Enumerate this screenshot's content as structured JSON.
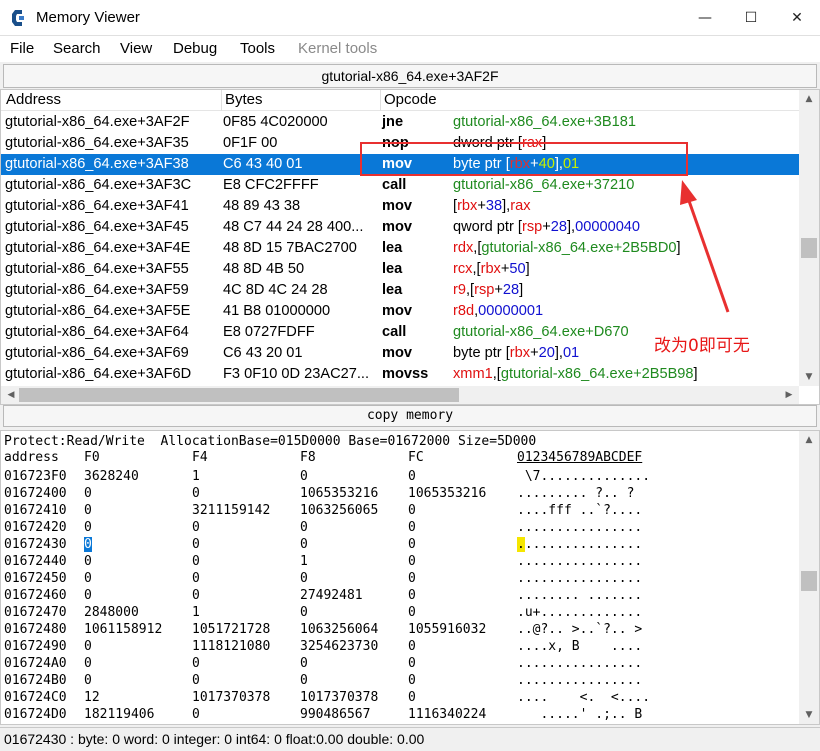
{
  "window": {
    "title": "Memory Viewer",
    "controls": {
      "minimize": "—",
      "maximize": "☐",
      "close": "✕"
    }
  },
  "menu": [
    "File",
    "Search",
    "View",
    "Debug",
    "Tools",
    "Kernel tools"
  ],
  "address_bar": "gtutorial-x86_64.exe+3AF2F",
  "disassembly": {
    "headers": {
      "address": "Address",
      "bytes": "Bytes",
      "opcode": "Opcode"
    },
    "rows": [
      {
        "address": "gtutorial-x86_64.exe+3AF2F",
        "bytes": "0F85 4C020000",
        "opcode": "jne",
        "args": [
          {
            "t": "gtutorial-x86_64.exe+3B181",
            "c": "green"
          }
        ]
      },
      {
        "address": "gtutorial-x86_64.exe+3AF35",
        "bytes": "0F1F 00",
        "opcode": "nop",
        "args": [
          {
            "t": "dword ptr [",
            "c": ""
          },
          {
            "t": "rax",
            "c": "red"
          },
          {
            "t": "]",
            "c": ""
          }
        ]
      },
      {
        "address": "gtutorial-x86_64.exe+3AF38",
        "bytes": "C6 43 40 01",
        "opcode": "mov",
        "selected": true,
        "args": [
          {
            "t": "byte ptr [",
            "c": ""
          },
          {
            "t": "rbx",
            "c": "reg"
          },
          {
            "t": "+",
            "c": ""
          },
          {
            "t": "40",
            "c": "num"
          },
          {
            "t": "],",
            "c": ""
          },
          {
            "t": "01",
            "c": "num"
          }
        ]
      },
      {
        "address": "gtutorial-x86_64.exe+3AF3C",
        "bytes": "E8 CFC2FFFF",
        "opcode": "call",
        "args": [
          {
            "t": "gtutorial-x86_64.exe+37210",
            "c": "green"
          }
        ]
      },
      {
        "address": "gtutorial-x86_64.exe+3AF41",
        "bytes": "48 89 43 38",
        "opcode": "mov",
        "args": [
          {
            "t": "[",
            "c": ""
          },
          {
            "t": "rbx",
            "c": "red"
          },
          {
            "t": "+",
            "c": ""
          },
          {
            "t": "38",
            "c": "blue"
          },
          {
            "t": "],",
            "c": ""
          },
          {
            "t": "rax",
            "c": "red"
          }
        ]
      },
      {
        "address": "gtutorial-x86_64.exe+3AF45",
        "bytes": "48 C7 44 24 28 400...",
        "opcode": "mov",
        "args": [
          {
            "t": "qword ptr [",
            "c": ""
          },
          {
            "t": "rsp",
            "c": "red"
          },
          {
            "t": "+",
            "c": ""
          },
          {
            "t": "28",
            "c": "blue"
          },
          {
            "t": "],",
            "c": ""
          },
          {
            "t": "00000040",
            "c": "blue"
          }
        ]
      },
      {
        "address": "gtutorial-x86_64.exe+3AF4E",
        "bytes": "48 8D 15 7BAC2700",
        "opcode": "lea",
        "args": [
          {
            "t": "rdx",
            "c": "red"
          },
          {
            "t": ",[",
            "c": ""
          },
          {
            "t": "gtutorial-x86_64.exe+2B5BD0",
            "c": "green"
          },
          {
            "t": "]",
            "c": ""
          }
        ]
      },
      {
        "address": "gtutorial-x86_64.exe+3AF55",
        "bytes": "48 8D 4B 50",
        "opcode": "lea",
        "args": [
          {
            "t": "rcx",
            "c": "red"
          },
          {
            "t": ",[",
            "c": ""
          },
          {
            "t": "rbx",
            "c": "red"
          },
          {
            "t": "+",
            "c": ""
          },
          {
            "t": "50",
            "c": "blue"
          },
          {
            "t": "]",
            "c": ""
          }
        ]
      },
      {
        "address": "gtutorial-x86_64.exe+3AF59",
        "bytes": "4C 8D 4C 24 28",
        "opcode": "lea",
        "args": [
          {
            "t": "r9",
            "c": "red"
          },
          {
            "t": ",[",
            "c": ""
          },
          {
            "t": "rsp",
            "c": "red"
          },
          {
            "t": "+",
            "c": ""
          },
          {
            "t": "28",
            "c": "blue"
          },
          {
            "t": "]",
            "c": ""
          }
        ]
      },
      {
        "address": "gtutorial-x86_64.exe+3AF5E",
        "bytes": "41 B8 01000000",
        "opcode": "mov",
        "args": [
          {
            "t": "r8d",
            "c": "red"
          },
          {
            "t": ",",
            "c": ""
          },
          {
            "t": "00000001",
            "c": "blue"
          }
        ]
      },
      {
        "address": "gtutorial-x86_64.exe+3AF64",
        "bytes": "E8 0727FDFF",
        "opcode": "call",
        "args": [
          {
            "t": "gtutorial-x86_64.exe+D670",
            "c": "green"
          }
        ]
      },
      {
        "address": "gtutorial-x86_64.exe+3AF69",
        "bytes": "C6 43 20 01",
        "opcode": "mov",
        "args": [
          {
            "t": "byte ptr [",
            "c": ""
          },
          {
            "t": "rbx",
            "c": "red"
          },
          {
            "t": "+",
            "c": ""
          },
          {
            "t": "20",
            "c": "blue"
          },
          {
            "t": "],",
            "c": ""
          },
          {
            "t": "01",
            "c": "blue"
          }
        ]
      },
      {
        "address": "gtutorial-x86_64.exe+3AF6D",
        "bytes": "F3 0F10 0D 23AC27...",
        "opcode": "movss",
        "args": [
          {
            "t": "xmm1",
            "c": "red"
          },
          {
            "t": ",[",
            "c": ""
          },
          {
            "t": "gtutorial-x86_64.exe+2B5B98",
            "c": "green"
          },
          {
            "t": "]",
            "c": ""
          }
        ]
      }
    ]
  },
  "copy_bar": "copy memory",
  "hex_view": {
    "info": "Protect:Read/Write  AllocationBase=015D0000 Base=01672000 Size=5D000",
    "headers": [
      "address",
      "F0",
      "F4",
      "F8",
      "FC",
      "0123456789ABCDEF"
    ],
    "rows": [
      [
        "016723F0",
        "3628240",
        "1",
        "0",
        "0",
        " \\7.............."
      ],
      [
        "01672400",
        "0",
        "0",
        "1065353216",
        "1065353216",
        "......... ?.. ?"
      ],
      [
        "01672410",
        "0",
        "3211159142",
        "1063256065",
        "0",
        "....fff ..`?...."
      ],
      [
        "01672420",
        "0",
        "0",
        "0",
        "0",
        "................"
      ],
      [
        "01672430",
        "0",
        "0",
        "0",
        "0",
        "................"
      ],
      [
        "01672440",
        "0",
        "0",
        "1",
        "0",
        "................"
      ],
      [
        "01672450",
        "0",
        "0",
        "0",
        "0",
        "................"
      ],
      [
        "01672460",
        "0",
        "0",
        "27492481",
        "0",
        "........ ......."
      ],
      [
        "01672470",
        "2848000",
        "1",
        "0",
        "0",
        ".u+............."
      ],
      [
        "01672480",
        "1061158912",
        "1051721728",
        "1063256064",
        "1055916032",
        "..@?.. >..`?.. >"
      ],
      [
        "01672490",
        "0",
        "1118121080",
        "3254623730",
        "0",
        "....x, B    ...."
      ],
      [
        "016724A0",
        "0",
        "0",
        "0",
        "0",
        "................"
      ],
      [
        "016724B0",
        "0",
        "0",
        "0",
        "0",
        "................"
      ],
      [
        "016724C0",
        "12",
        "1017370378",
        "1017370378",
        "0",
        "....    <.  <...."
      ],
      [
        "016724D0",
        "182119406",
        "0",
        "990486567",
        "1116340224",
        "   .....' .;.. B"
      ]
    ],
    "selected_row": 4
  },
  "status_bar": "01672430 : byte: 0 word: 0 integer: 0 int64: 0 float:0.00 double: 0.00",
  "annotation": {
    "text": "改为0即可无",
    "color": "#e81818"
  }
}
